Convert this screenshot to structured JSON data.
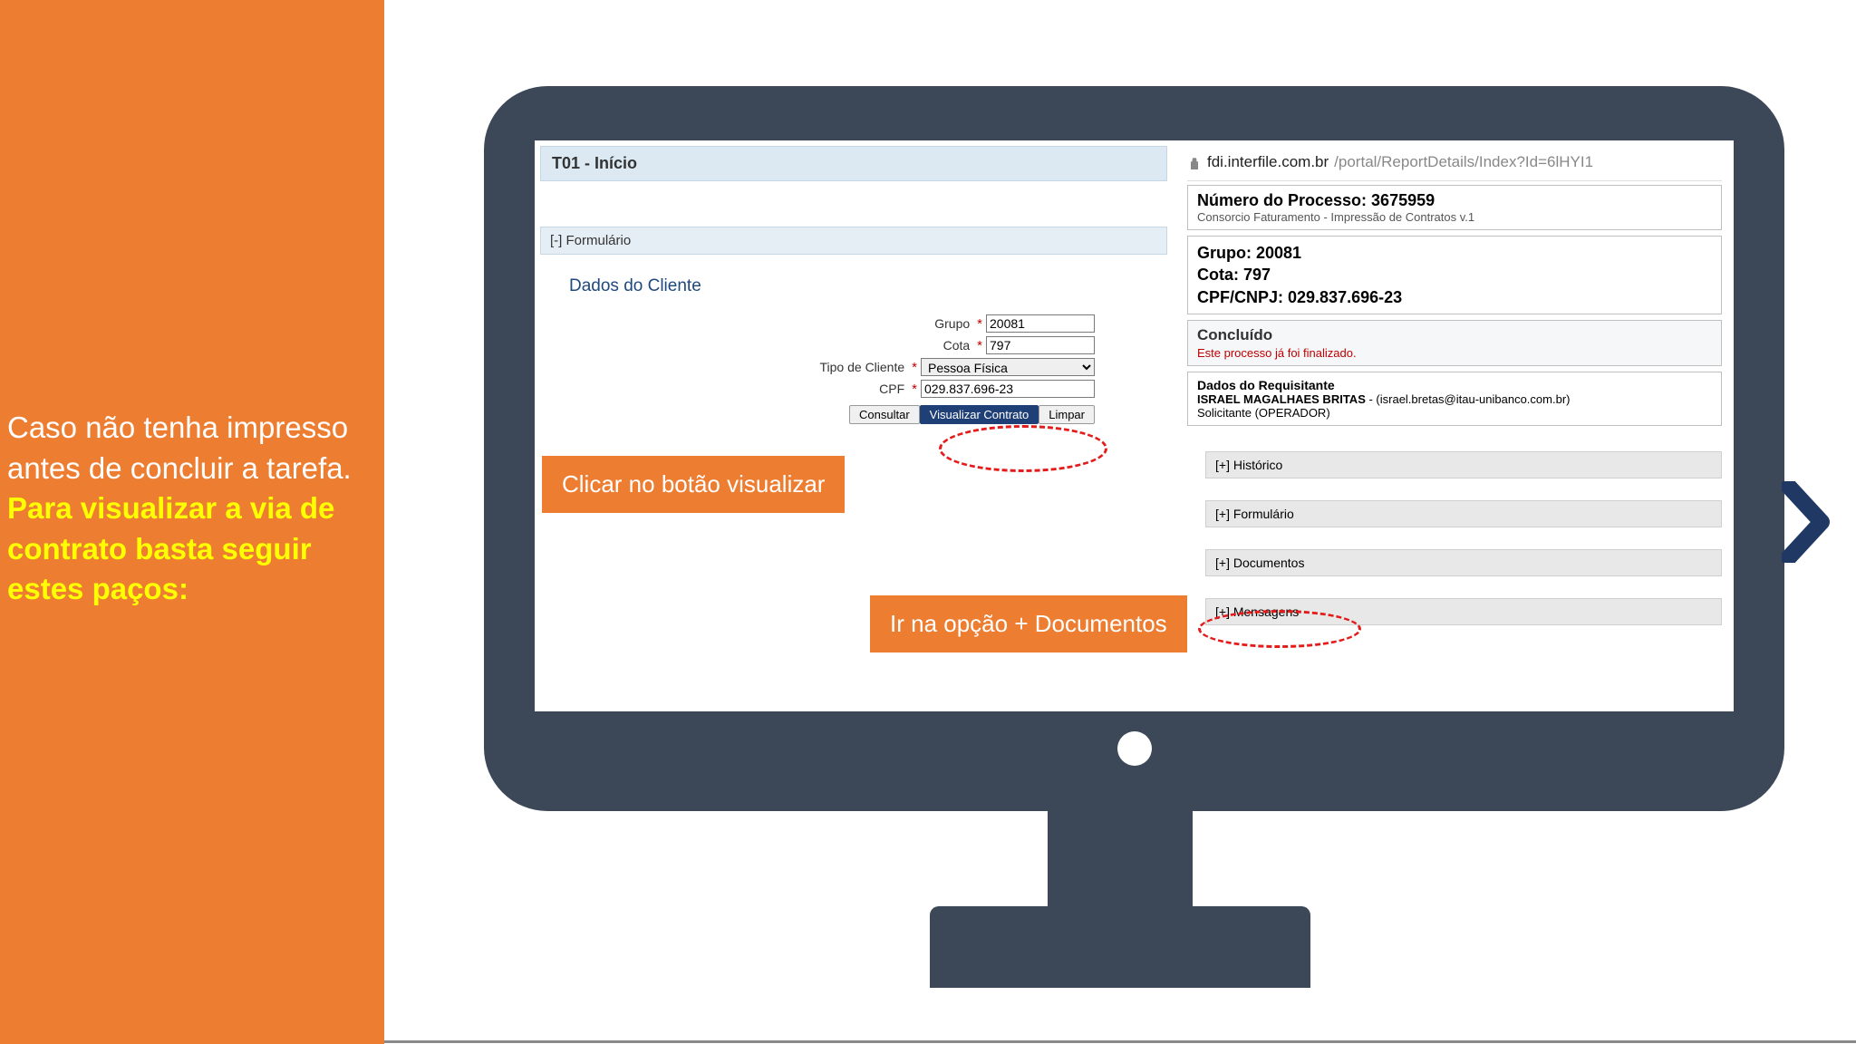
{
  "sidebar": {
    "text_plain": "Caso não tenha impresso antes de concluir a tarefa. ",
    "text_highlight": "Para visualizar a via de contrato basta seguir estes paços:"
  },
  "screen": {
    "title": "T01 - Início",
    "form_header": "[-] Formulário",
    "section_title": "Dados do Cliente",
    "labels": {
      "grupo": "Grupo",
      "cota": "Cota",
      "tipo_cliente": "Tipo de Cliente",
      "cpf": "CPF"
    },
    "values": {
      "grupo": "20081",
      "cota": "797",
      "tipo_cliente": "Pessoa Física",
      "cpf": "029.837.696-23"
    },
    "buttons": {
      "consultar": "Consultar",
      "visualizar": "Visualizar Contrato",
      "limpar": "Limpar"
    }
  },
  "callouts": {
    "visualizar": "Clicar no botão visualizar",
    "documentos": "Ir na opção + Documentos"
  },
  "report": {
    "url_host": "fdi.interfile.com.br",
    "url_path": "/portal/ReportDetails/Index?Id=6lHYI1",
    "proc_num_label": "Número do Processo: 3675959",
    "proc_sub": "Consorcio Faturamento - Impressão de Contratos v.1",
    "grupo": "Grupo: 20081",
    "cota": "Cota: 797",
    "cpf": "CPF/CNPJ: 029.837.696-23",
    "status_title": "Concluído",
    "status_sub": "Este processo já foi finalizado.",
    "req_title": "Dados do Requisitante",
    "req_name": "ISRAEL MAGALHAES BRITAS",
    "req_email": " - (israel.bretas@itau-unibanco.com.br)",
    "req_role": "Solicitante (OPERADOR)",
    "accordion": {
      "historico": "[+] Histórico",
      "formulario": "[+] Formulário",
      "documentos": "[+] Documentos",
      "mensagens": "[+] Mensagens"
    }
  }
}
